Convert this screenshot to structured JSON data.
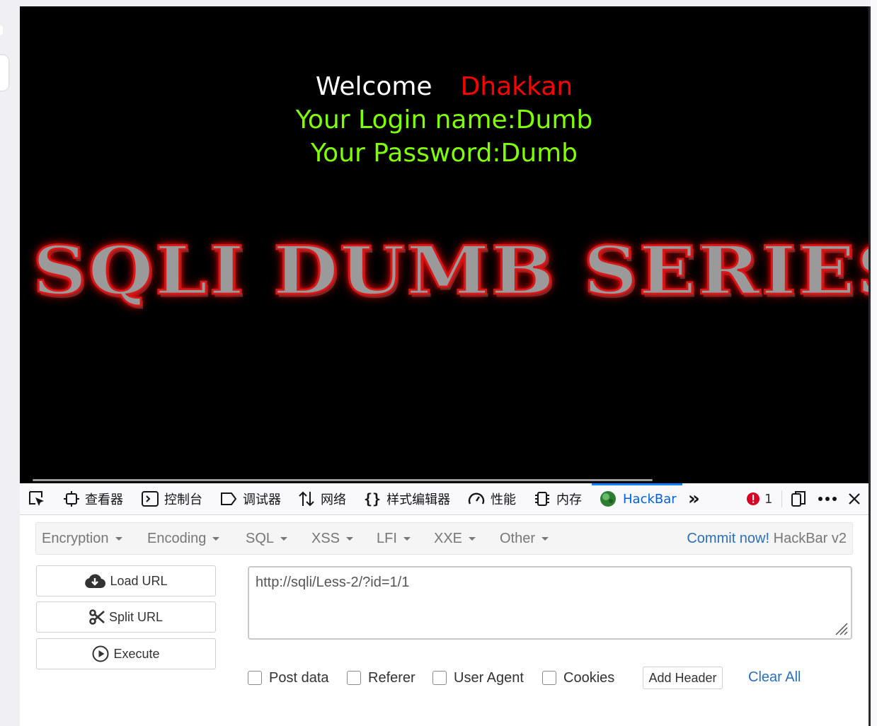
{
  "page": {
    "welcome_label": "Welcome",
    "welcome_name": "Dhakkan",
    "login_line": "Your Login name:Dumb",
    "password_line": "Your Password:Dumb",
    "banner_text": "SQLI DUMB SERIES"
  },
  "devtools": {
    "tabs": [
      {
        "label": "",
        "icon": "element-picker-icon"
      },
      {
        "label": "查看器",
        "icon": "inspector-icon"
      },
      {
        "label": "控制台",
        "icon": "console-icon"
      },
      {
        "label": "调试器",
        "icon": "debugger-icon"
      },
      {
        "label": "网络",
        "icon": "network-icon"
      },
      {
        "label": "样式编辑器",
        "icon": "style-editor-icon"
      },
      {
        "label": "性能",
        "icon": "performance-icon"
      },
      {
        "label": "内存",
        "icon": "memory-icon"
      },
      {
        "label": "HackBar",
        "icon": "hackbar-icon"
      }
    ],
    "active_tab": "HackBar",
    "error_count": "1"
  },
  "hackbar": {
    "menu": [
      "Encryption",
      "Encoding",
      "SQL",
      "XSS",
      "LFI",
      "XXE",
      "Other"
    ],
    "commit_label": "Commit now!",
    "version_label": "HackBar v2",
    "load_url_label": "Load URL",
    "split_url_label": "Split URL",
    "execute_label": "Execute",
    "url_value": "http://sqli/Less-2/?id=1/1",
    "options": [
      {
        "label": "Post data",
        "checked": false
      },
      {
        "label": "Referer",
        "checked": false
      },
      {
        "label": "User Agent",
        "checked": false
      },
      {
        "label": "Cookies",
        "checked": false
      }
    ],
    "add_header_label": "Add Header",
    "clear_all_label": "Clear All"
  },
  "colors": {
    "welcome_name": "#ff0000",
    "login_text": "#7fff00",
    "link_blue": "#2a6fb8",
    "active_tab": "#0060df"
  }
}
